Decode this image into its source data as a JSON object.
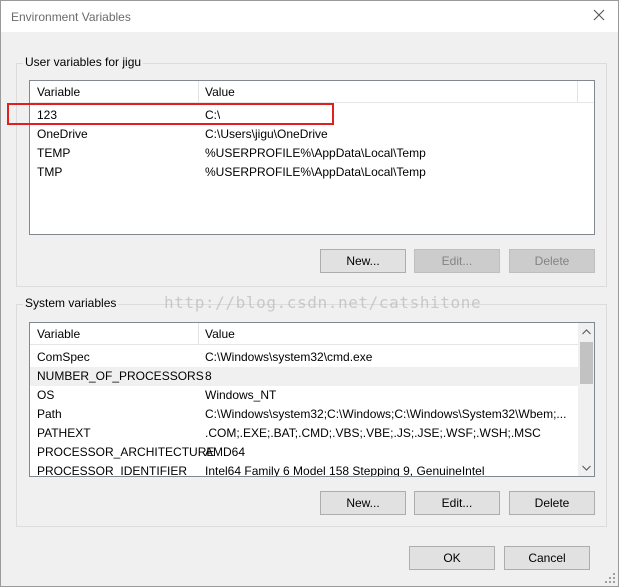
{
  "window": {
    "title": "Environment Variables"
  },
  "user_vars": {
    "label": "User variables for jigu",
    "columns": [
      "Variable",
      "Value"
    ],
    "rows": [
      {
        "variable": "123",
        "value": "C:\\"
      },
      {
        "variable": "OneDrive",
        "value": "C:\\Users\\jigu\\OneDrive"
      },
      {
        "variable": "TEMP",
        "value": "%USERPROFILE%\\AppData\\Local\\Temp"
      },
      {
        "variable": "TMP",
        "value": "%USERPROFILE%\\AppData\\Local\\Temp"
      }
    ],
    "buttons": {
      "new": "New...",
      "edit": "Edit...",
      "delete": "Delete"
    }
  },
  "system_vars": {
    "label": "System variables",
    "columns": [
      "Variable",
      "Value"
    ],
    "rows": [
      {
        "variable": "ComSpec",
        "value": "C:\\Windows\\system32\\cmd.exe"
      },
      {
        "variable": "NUMBER_OF_PROCESSORS",
        "value": "8"
      },
      {
        "variable": "OS",
        "value": "Windows_NT"
      },
      {
        "variable": "Path",
        "value": "C:\\Windows\\system32;C:\\Windows;C:\\Windows\\System32\\Wbem;..."
      },
      {
        "variable": "PATHEXT",
        "value": ".COM;.EXE;.BAT;.CMD;.VBS;.VBE;.JS;.JSE;.WSF;.WSH;.MSC"
      },
      {
        "variable": "PROCESSOR_ARCHITECTURE",
        "value": "AMD64"
      },
      {
        "variable": "PROCESSOR_IDENTIFIER",
        "value": "Intel64 Family 6 Model 158 Stepping 9, GenuineIntel"
      }
    ],
    "buttons": {
      "new": "New...",
      "edit": "Edit...",
      "delete": "Delete"
    }
  },
  "dialog_buttons": {
    "ok": "OK",
    "cancel": "Cancel"
  },
  "watermark": "http://blog.csdn.net/catshitone",
  "colors": {
    "annotation": "#e02020",
    "selected_row": "#f0f0f0",
    "disabled_text": "#838383"
  },
  "icons": {
    "close": "close-icon",
    "scroll_up": "chevron-up-icon",
    "scroll_down": "chevron-down-icon"
  }
}
